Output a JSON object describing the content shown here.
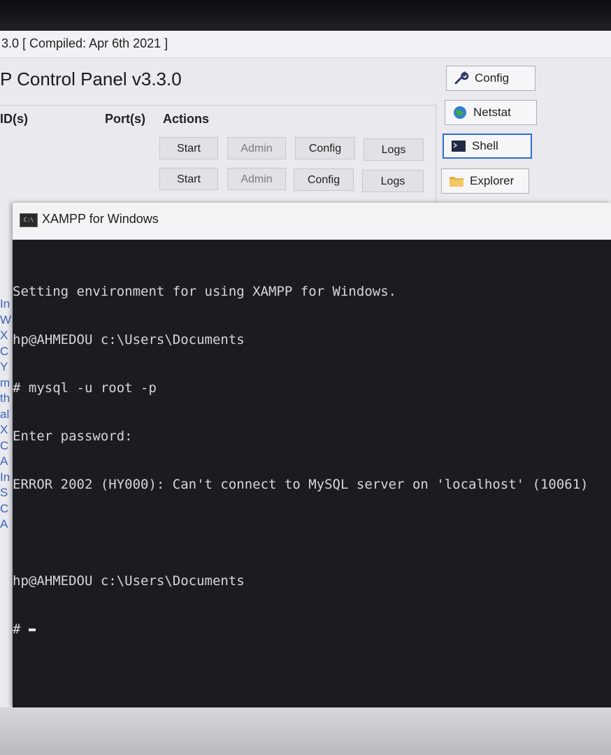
{
  "control_panel": {
    "version_line": "3.0  [ Compiled: Apr 6th 2021 ]",
    "title": "P Control Panel v3.3.0",
    "columns": {
      "pids": "ID(s)",
      "ports": "Port(s)",
      "actions": "Actions"
    },
    "rows": [
      {
        "start": "Start",
        "admin": "Admin",
        "config": "Config",
        "logs": "Logs"
      },
      {
        "start": "Start",
        "admin": "Admin",
        "config": "Config",
        "logs": "Logs"
      }
    ],
    "side_buttons": {
      "config": "Config",
      "netstat": "Netstat",
      "shell": "Shell",
      "explorer": "Explorer"
    },
    "log_fragments": [
      "In",
      "W",
      "X",
      "C",
      "Y",
      "m",
      "th",
      "al",
      "X",
      "C",
      "A",
      "In",
      "S",
      "C",
      "A"
    ]
  },
  "terminal": {
    "title": "XAMPP for Windows",
    "icon_label": "C:\\",
    "lines": [
      "Setting environment for using XAMPP for Windows.",
      "hp@AHMEDOU c:\\Users\\Documents",
      "# mysql -u root -p",
      "Enter password:",
      "ERROR 2002 (HY000): Can't connect to MySQL server on 'localhost' (10061)",
      "",
      "hp@AHMEDOU c:\\Users\\Documents",
      "# "
    ]
  },
  "colors": {
    "terminal_bg": "#1a1c22",
    "terminal_text": "#d6d6dc",
    "panel_bg": "#e9e9ee",
    "accent": "#2b6fd6"
  }
}
